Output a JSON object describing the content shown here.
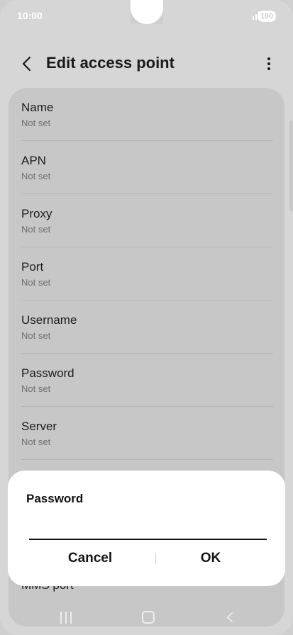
{
  "status_bar": {
    "time": "10:00",
    "battery": "100"
  },
  "header": {
    "title": "Edit access point",
    "back_icon": "chevron-left-icon",
    "more_icon": "more-vertical-icon"
  },
  "settings": [
    {
      "label": "Name",
      "value": "Not set"
    },
    {
      "label": "APN",
      "value": "Not set"
    },
    {
      "label": "Proxy",
      "value": "Not set"
    },
    {
      "label": "Port",
      "value": "Not set"
    },
    {
      "label": "Username",
      "value": "Not set"
    },
    {
      "label": "Password",
      "value": "Not set"
    },
    {
      "label": "Server",
      "value": "Not set"
    }
  ],
  "partially_hidden_item": "MMS port",
  "dialog": {
    "title": "Password",
    "input_value": "",
    "cancel_label": "Cancel",
    "ok_label": "OK"
  },
  "nav_bar": {
    "recents_icon": "recents-icon",
    "home_icon": "home-icon",
    "back_icon": "back-icon"
  },
  "colors": {
    "background": "#cfcfcf",
    "card": "#c7c7c7",
    "dialog": "#ffffff",
    "text_primary": "#1d1d1d",
    "text_secondary": "#6f6f6f"
  }
}
